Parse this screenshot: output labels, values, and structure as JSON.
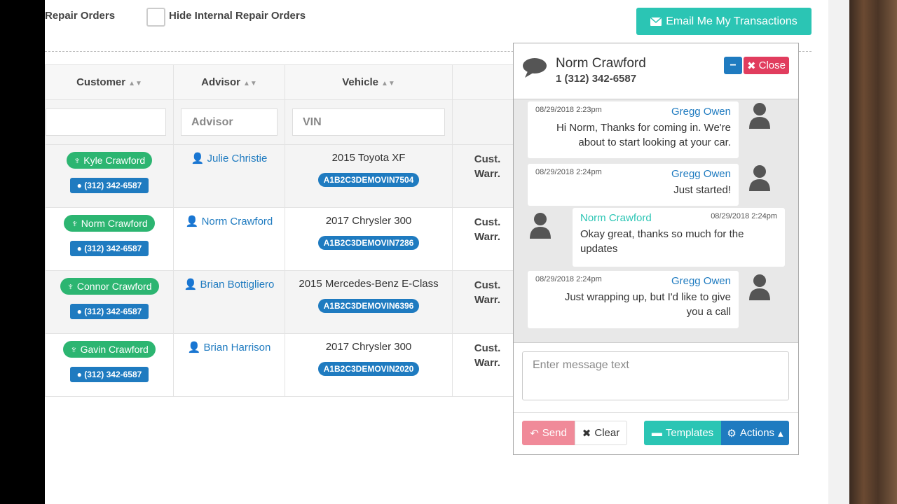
{
  "topbar": {
    "repair_orders_label": "Repair Orders",
    "hide_internal_label": "Hide Internal Repair Orders",
    "email_button_label": "Email Me My Transactions"
  },
  "table": {
    "headers": [
      "Customer",
      "Advisor",
      "Vehicle"
    ],
    "filters": {
      "customer_placeholder": "",
      "advisor_placeholder": "Advisor",
      "vin_placeholder": "VIN"
    },
    "rows": [
      {
        "customer": "Kyle Crawford",
        "phone": "(312) 342-6587",
        "advisor": "Julie Christie",
        "vehicle": "2015 Toyota XF",
        "vin": "A1B2C3DEMOVIN7504",
        "pay1": "Cust.",
        "pay2": "Warr."
      },
      {
        "customer": "Norm Crawford",
        "phone": "(312) 342-6587",
        "advisor": "Norm Crawford",
        "vehicle": "2017 Chrysler 300",
        "vin": "A1B2C3DEMOVIN7286",
        "pay1": "Cust.",
        "pay2": "Warr."
      },
      {
        "customer": "Connor Crawford",
        "phone": "(312) 342-6587",
        "advisor": "Brian Bottigliero",
        "vehicle": "2015 Mercedes-Benz E-Class",
        "vin": "A1B2C3DEMOVIN6396",
        "pay1": "Cust.",
        "pay2": "Warr."
      },
      {
        "customer": "Gavin Crawford",
        "phone": "(312) 342-6587",
        "advisor": "Brian Harrison",
        "vehicle": "2017 Chrysler 300",
        "vin": "A1B2C3DEMOVIN2020",
        "pay1": "Cust.",
        "pay2": "Warr."
      }
    ]
  },
  "chat": {
    "contact_name": "Norm Crawford",
    "contact_phone": "1 (312) 342-6587",
    "close_label": "Close",
    "messages": [
      {
        "time": "08/29/2018 2:23pm",
        "sender": "Gregg Owen",
        "line1": "Hi Norm, Thanks for coming in. We're",
        "line2": "about to start looking at your car."
      },
      {
        "time": "08/29/2018 2:24pm",
        "sender": "Gregg Owen",
        "line1": "Just started!",
        "line2": ""
      },
      {
        "time": "08/29/2018 2:24pm",
        "sender": "Norm Crawford",
        "line1": "Okay great, thanks so much for the",
        "line2": "updates"
      },
      {
        "time": "08/29/2018 2:24pm",
        "sender": "Gregg Owen",
        "line1": "Just wrapping up, but I'd like to give",
        "line2": "you a call"
      }
    ],
    "input_placeholder": "Enter message text",
    "send_label": "Send",
    "clear_label": "Clear",
    "templates_label": "Templates",
    "actions_label": "Actions"
  },
  "colors": {
    "teal": "#2bc5b4",
    "blue": "#1f7bc0",
    "green": "#2cb571",
    "red": "#e13d5e",
    "pink": "#f08a99"
  }
}
